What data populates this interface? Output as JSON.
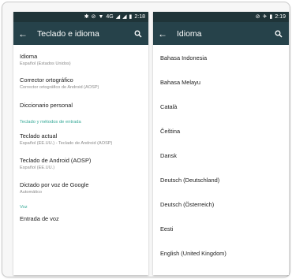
{
  "left": {
    "status": {
      "time": "2:18",
      "network": "4G"
    },
    "appbar": {
      "title": "Teclado e idioma"
    },
    "items": [
      {
        "title": "Idioma",
        "subtitle": "Español (Estados Unidos)"
      },
      {
        "title": "Corrector ortográfico",
        "subtitle": "Corrector ortográfico de Android (AOSP)"
      },
      {
        "title": "Diccionario personal",
        "subtitle": ""
      }
    ],
    "section_input": "Teclado y métodos de entrada",
    "input_items": [
      {
        "title": "Teclado actual",
        "subtitle": "Español (EE.UU.) - Teclado de Android (AOSP)"
      },
      {
        "title": "Teclado de Android (AOSP)",
        "subtitle": "Español (EE.UU.)"
      },
      {
        "title": "Dictado por voz de Google",
        "subtitle": "Automático"
      }
    ],
    "section_voice": "Voz",
    "voice_items": [
      {
        "title": "Entrada de voz"
      }
    ]
  },
  "right": {
    "status": {
      "time": "2:19"
    },
    "appbar": {
      "title": "Idioma"
    },
    "languages": [
      "Bahasa Indonesia",
      "Bahasa Melayu",
      "Català",
      "Čeština",
      "Dansk",
      "Deutsch (Deutschland)",
      "Deutsch (Österreich)",
      "Eesti",
      "English (United Kingdom)"
    ]
  },
  "colors": {
    "statusbar": "#1f3438",
    "appbar": "#26424a",
    "accent": "#34a896"
  }
}
